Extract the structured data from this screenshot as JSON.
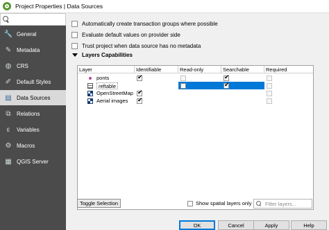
{
  "window": {
    "title": "Project Properties | Data Sources"
  },
  "sidebar": {
    "search_placeholder": "",
    "items": [
      {
        "label": "General",
        "icon": "wrench-icon"
      },
      {
        "label": "Metadata",
        "icon": "metadata-icon"
      },
      {
        "label": "CRS",
        "icon": "globe-icon"
      },
      {
        "label": "Default Styles",
        "icon": "styles-icon"
      },
      {
        "label": "Data Sources",
        "icon": "data-sources-icon"
      },
      {
        "label": "Relations",
        "icon": "relations-icon"
      },
      {
        "label": "Variables",
        "icon": "variables-icon"
      },
      {
        "label": "Macros",
        "icon": "macros-icon"
      },
      {
        "label": "QGIS Server",
        "icon": "server-icon"
      }
    ],
    "active_index": 4
  },
  "options": [
    {
      "label": "Automatically create transaction groups where possible",
      "checked": false
    },
    {
      "label": "Evaluate default values on provider side",
      "checked": false
    },
    {
      "label": "Trust project when data source has no metadata",
      "checked": false
    }
  ],
  "layer_caps": {
    "heading": "Layers Capabilities",
    "columns": [
      "Layer",
      "Identifiable",
      "Read-only",
      "Searchable",
      "Required"
    ],
    "rows": [
      {
        "name": "ponts",
        "icon": "point-layer-icon",
        "identifiable": true,
        "readonly": false,
        "searchable": true,
        "required": false,
        "selected": false
      },
      {
        "name": "reftable",
        "icon": "table-layer-icon",
        "identifiable": false,
        "readonly": false,
        "searchable": true,
        "required": false,
        "selected": true
      },
      {
        "name": "OpenStreetMap",
        "icon": "raster-layer-icon",
        "identifiable": true,
        "readonly": null,
        "searchable": null,
        "required": null,
        "selected": false
      },
      {
        "name": "Aerial images",
        "icon": "raster-layer-icon",
        "identifiable": true,
        "readonly": null,
        "searchable": null,
        "required": null,
        "selected": false
      }
    ],
    "toggle_label": "Toggle Selection",
    "spatial_only_label": "Show spatial layers only",
    "filter_placeholder": "Filter layers..."
  },
  "buttons": {
    "ok": "OK",
    "cancel": "Cancel",
    "apply": "Apply",
    "help": "Help"
  }
}
